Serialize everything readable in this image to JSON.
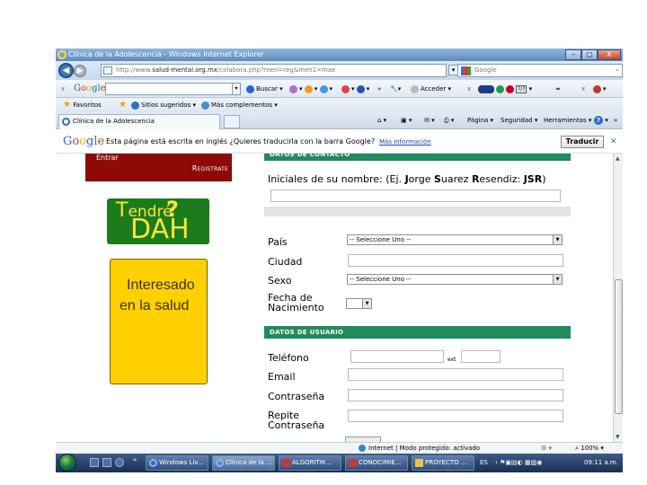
{
  "window": {
    "title": "Clínica de la Adolescencia - Windows Internet Explorer",
    "minimize_label": "–",
    "maximize_label": "▢",
    "close_label": "X"
  },
  "address_bar": {
    "url_prefix": "http://www.",
    "url_domain": "salud-mental.org.mx",
    "url_path": "/colabora.php?men=reg&men1=mae",
    "search_engine": "Google"
  },
  "google_toolbar": {
    "close": "x",
    "logo": [
      "G",
      "o",
      "o",
      "g",
      "l",
      "e"
    ],
    "search_button": "Buscar",
    "more": "»",
    "signin": "Acceder",
    "close2": "x"
  },
  "favorites_bar": {
    "favorites": "Favoritos",
    "suggested_sites": "Sitios sugeridos ▾",
    "more_addons": "Más complementos ▾"
  },
  "tabs": {
    "active_tab": "Clínica de la Adolescencia"
  },
  "command_bar": {
    "page": "Página ▾",
    "security": "Seguridad ▾",
    "tools": "Herramientas ▾",
    "help": "?",
    "more": "»"
  },
  "translate_bar": {
    "logo": "Google",
    "message": "Esta página está escrita en inglés  ¿Quieres traducirla con la barra Google?",
    "more_info": "Más información",
    "translate_button": "Traducir",
    "close": "✕"
  },
  "sidebar": {
    "entrar": "Entrar",
    "register": "Registrate",
    "tdah_line1": "endré",
    "tdah_t": "T",
    "tdah_q": "?",
    "tdah_line2": "DAH",
    "interest_line1": "Interesado",
    "interest_line2": "en la salud"
  },
  "form": {
    "contact_header": "DATOS DE CONTACTO",
    "initials_label_pre": "Iniciales de su nombre: (Ej. ",
    "initials_J": "J",
    "initials_orge": "orge ",
    "initials_S": "S",
    "initials_uarez": "uarez ",
    "initials_R": "R",
    "initials_esendiz": "esendiz: ",
    "initials_code": "JSR",
    "initials_close": ")",
    "country_label": "País",
    "country_value": "-- Seleccione Uno --",
    "city_label": "Ciudad",
    "sex_label": "Sexo",
    "sex_value": "-- Seleccione Uno --",
    "birth_label_1": "Fecha de",
    "birth_label_2": "Nacimiento",
    "user_header": "DATOS DE USUARIO",
    "phone_label": "Teléfono",
    "ext_label": "ext",
    "email_label": "Email",
    "password_label": "Contraseña",
    "repeat_label_1": "Repite",
    "repeat_label_2": "Contraseña"
  },
  "status_bar": {
    "zone": "Internet | Modo protegido: activado",
    "zoom": "100%  ▾"
  },
  "taskbar": {
    "tasks": [
      "Windows Liv...",
      "Clínica de la ...",
      "ALGORITM...",
      "CONOCIMIE...",
      "PROYECTO ..."
    ],
    "language": "ES",
    "clock": "09:11 a.m."
  }
}
